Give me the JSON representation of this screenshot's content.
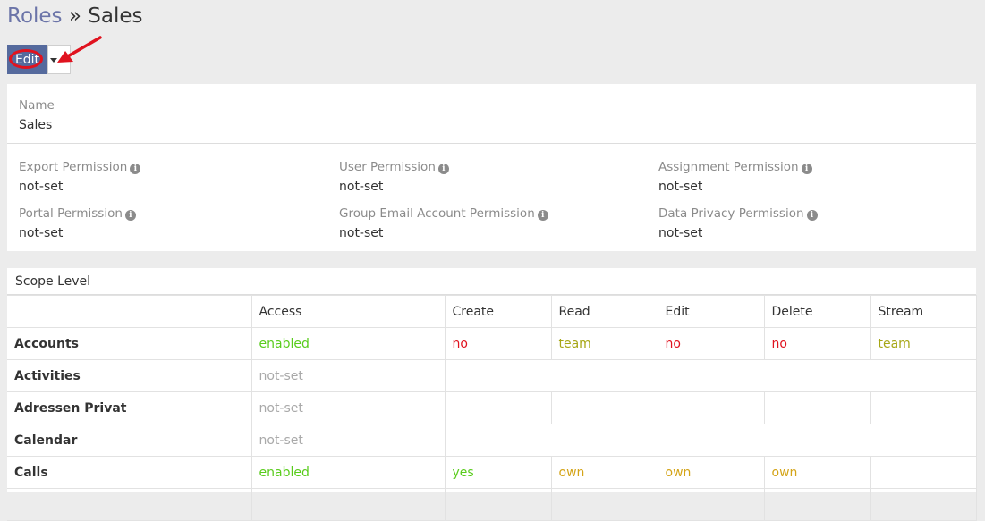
{
  "breadcrumb": {
    "parent": "Roles",
    "separator": "»",
    "current": "Sales"
  },
  "toolbar": {
    "edit_label": "Edit"
  },
  "details": {
    "name_label": "Name",
    "name_value": "Sales",
    "permissions": [
      {
        "label": "Export Permission",
        "value": "not-set"
      },
      {
        "label": "User Permission",
        "value": "not-set"
      },
      {
        "label": "Assignment Permission",
        "value": "not-set"
      },
      {
        "label": "Portal Permission",
        "value": "not-set"
      },
      {
        "label": "Group Email Account Permission",
        "value": "not-set"
      },
      {
        "label": "Data Privacy Permission",
        "value": "not-set"
      }
    ],
    "info_glyph": "i"
  },
  "scope": {
    "title": "Scope Level",
    "columns": [
      "",
      "Access",
      "Create",
      "Read",
      "Edit",
      "Delete",
      "Stream"
    ],
    "rows": [
      {
        "name": "Accounts",
        "access": "enabled",
        "create": "no",
        "read": "team",
        "edit": "no",
        "delete": "no",
        "stream": "team"
      },
      {
        "name": "Activities",
        "access": "not-set"
      },
      {
        "name": "Adressen Privat",
        "access": "not-set",
        "create": "",
        "read": "",
        "edit": "",
        "delete": "",
        "stream": ""
      },
      {
        "name": "Calendar",
        "access": "not-set"
      },
      {
        "name": "Calls",
        "access": "enabled",
        "create": "yes",
        "read": "own",
        "edit": "own",
        "delete": "own",
        "stream": ""
      }
    ]
  },
  "colors": {
    "enabled": "#59cc1c",
    "no": "#e0131f",
    "team": "#a6a615",
    "own": "#d4a418",
    "yes": "#59cc1c",
    "not-set": "#a9a9a9",
    "accent": "#556a9d",
    "annotation": "#e0131f"
  }
}
